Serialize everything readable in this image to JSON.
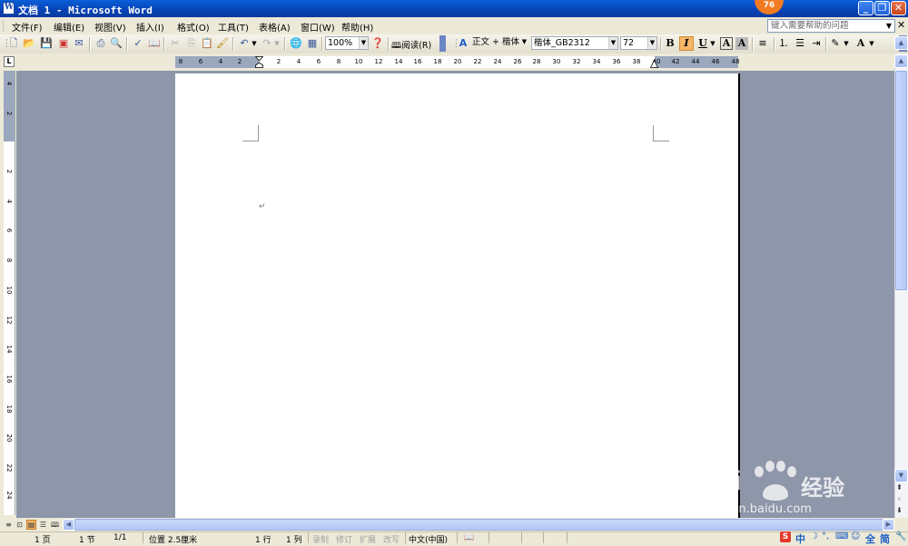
{
  "window": {
    "title": "文档 1 - Microsoft Word",
    "badge_count": "76"
  },
  "menubar": {
    "items": [
      "文件(F)",
      "编辑(E)",
      "视图(V)",
      "插入(I)",
      "格式(O)",
      "工具(T)",
      "表格(A)",
      "窗口(W)",
      "帮助(H)"
    ],
    "help_placeholder": "键入需要帮助的问题"
  },
  "toolbar": {
    "zoom": "100%",
    "read_label": "阅读(R)",
    "style": "正文 + 楷体",
    "font": "楷体_GB2312",
    "size": "72",
    "bold": "B",
    "italic": "I",
    "underline": "U",
    "char_border": "A",
    "char_shading": "A",
    "font_color_letter": "A"
  },
  "ruler": {
    "h_left_numbers": [
      "8",
      "6",
      "4",
      "2"
    ],
    "h_numbers": [
      "2",
      "4",
      "6",
      "8",
      "10",
      "12",
      "14",
      "16",
      "18",
      "20",
      "22",
      "24",
      "26",
      "28",
      "30",
      "32",
      "34",
      "36",
      "38",
      "40",
      "42",
      "44",
      "46",
      "48"
    ],
    "v_top_numbers": [
      "4",
      "2"
    ],
    "v_numbers": [
      "2",
      "4",
      "6",
      "8",
      "10",
      "12",
      "14",
      "16",
      "18",
      "20",
      "22",
      "24"
    ]
  },
  "statusbar": {
    "page": "1 页",
    "section": "1 节",
    "page_of": "1/1",
    "position": "位置 2.5厘米",
    "line": "1 行",
    "column": "1 列",
    "rec": "录制",
    "trk": "修订",
    "ext": "扩展",
    "ovr": "改写",
    "language": "中文(中国)"
  },
  "tray": {
    "ime": "中",
    "full": "全",
    "simp": "简"
  },
  "watermark": {
    "brand": "Bai",
    "brand2": "经验",
    "url": "jingyan.baidu.com"
  },
  "colors": {
    "titlebar": "#0842b5",
    "workspace": "#8e96a9",
    "ruler_margin": "#9aa7bd",
    "active_button": "#f6b769",
    "font_color_bar": "#e03030",
    "highlight_bar": "#ffff00"
  }
}
